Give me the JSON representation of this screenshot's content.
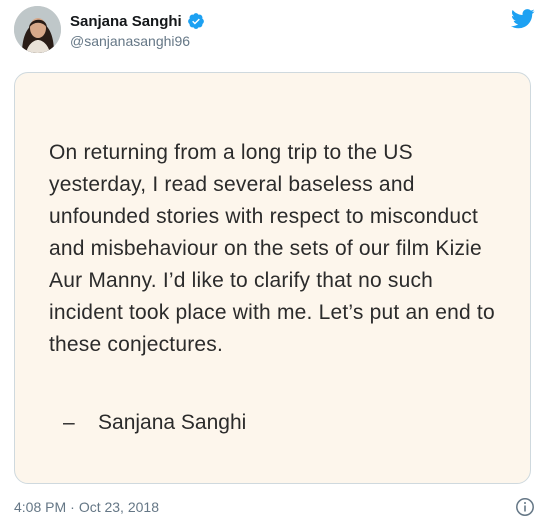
{
  "author": {
    "display_name": "Sanjana Sanghi",
    "handle": "@sanjanasanghi96"
  },
  "note": {
    "body": "On returning from a long trip to the US yesterday, I read several baseless and unfounded stories with respect to misconduct and misbehaviour on the sets of our film Kizie Aur Manny. I’d like to clarify that no such incident took place with me. Let’s put an end to these conjectures.",
    "signature": "–    Sanjana Sanghi"
  },
  "footer": {
    "time": "4:08 PM",
    "separator": "·",
    "date": "Oct 23, 2018"
  },
  "colors": {
    "verified_blue": "#1da1f2",
    "twitter_blue": "#1da1f2",
    "card_background": "#fdf6ec"
  },
  "icons": {
    "brand": "twitter-bird-icon",
    "verified": "verified-badge-icon",
    "info": "info-icon"
  }
}
